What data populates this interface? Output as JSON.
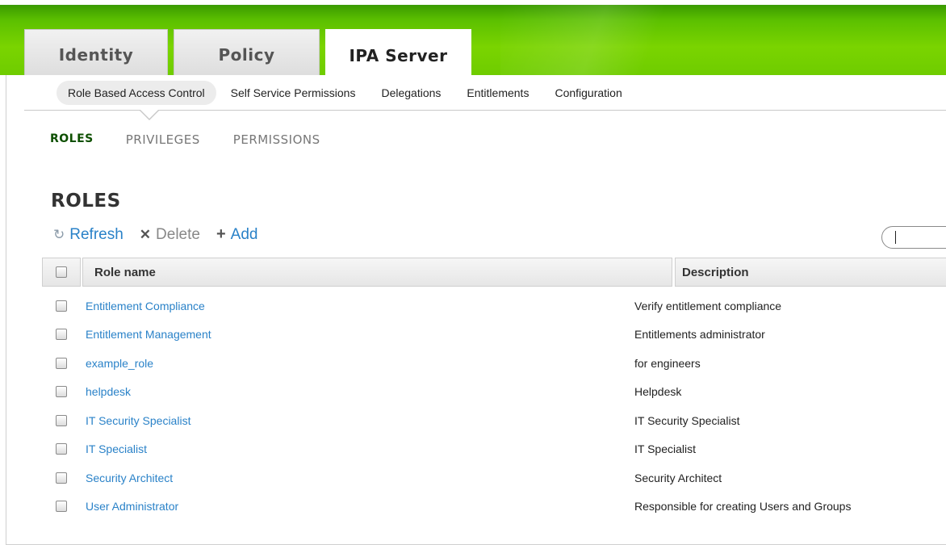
{
  "top_tabs": [
    {
      "label": "Identity",
      "active": false
    },
    {
      "label": "Policy",
      "active": false
    },
    {
      "label": "IPA Server",
      "active": true
    }
  ],
  "sub_nav": [
    {
      "label": "Role Based Access Control",
      "active": true
    },
    {
      "label": "Self Service Permissions",
      "active": false
    },
    {
      "label": "Delegations",
      "active": false
    },
    {
      "label": "Entitlements",
      "active": false
    },
    {
      "label": "Configuration",
      "active": false
    }
  ],
  "facets": [
    {
      "label": "ROLES",
      "active": true
    },
    {
      "label": "PRIVILEGES",
      "active": false
    },
    {
      "label": "PERMISSIONS",
      "active": false
    }
  ],
  "page_title": "ROLES",
  "actions": {
    "refresh_label": "Refresh",
    "delete_label": "Delete",
    "add_label": "Add"
  },
  "search": {
    "value": ""
  },
  "table": {
    "headers": {
      "name": "Role name",
      "description": "Description"
    },
    "rows": [
      {
        "name": "Entitlement Compliance",
        "description": "Verify entitlement compliance"
      },
      {
        "name": "Entitlement Management",
        "description": "Entitlements administrator"
      },
      {
        "name": "example_role",
        "description": "for engineers"
      },
      {
        "name": "helpdesk",
        "description": "Helpdesk"
      },
      {
        "name": "IT Security Specialist",
        "description": "IT Security Specialist"
      },
      {
        "name": "IT Specialist",
        "description": "IT Specialist"
      },
      {
        "name": "Security Architect",
        "description": "Security Architect"
      },
      {
        "name": "User Administrator",
        "description": "Responsible for creating Users and Groups"
      }
    ]
  },
  "colors": {
    "header_green": "#6fcc00",
    "link_blue": "#2a82c8",
    "active_facet": "#0d4f00"
  }
}
